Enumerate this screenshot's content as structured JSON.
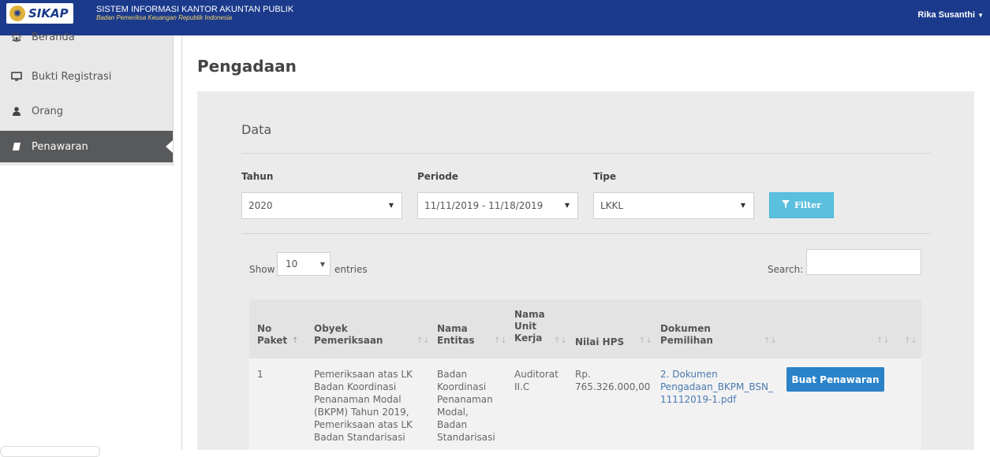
{
  "header": {
    "logo_text": "SIKAP",
    "title": "SISTEM INFORMASI KANTOR AKUNTAN PUBLIK",
    "subtitle": "Badan Pemeriksa Keuangan Republik Indonesia",
    "user_name": "Rika Susanthi"
  },
  "sidebar": {
    "items": [
      {
        "label": "Beranda",
        "icon": "home-icon"
      },
      {
        "label": "Bukti Registrasi",
        "icon": "monitor-icon"
      },
      {
        "label": "Orang",
        "icon": "user-icon"
      },
      {
        "label": "Penawaran",
        "icon": "book-icon",
        "active": true
      }
    ]
  },
  "page": {
    "title": "Pengadaan",
    "section_title": "Data"
  },
  "filters": {
    "tahun": {
      "label": "Tahun",
      "value": "2020"
    },
    "periode": {
      "label": "Periode",
      "value": "11/11/2019 - 11/18/2019"
    },
    "tipe": {
      "label": "Tipe",
      "value": "LKKL"
    },
    "filter_label": "Filter"
  },
  "table_controls": {
    "show_label": "Show",
    "page_length": "10",
    "entries_label": "entries",
    "search_label": "Search:",
    "search_value": ""
  },
  "table": {
    "headers": [
      {
        "line1": "No",
        "line2": "Paket"
      },
      {
        "line1": "Obyek",
        "line2": "Pemeriksaan"
      },
      {
        "line1": "Nama",
        "line2": "Entitas"
      },
      {
        "line1": "Nama",
        "line2": "Unit",
        "line3": "Kerja"
      },
      {
        "line1": "Nilai HPS"
      },
      {
        "line1": "Dokumen",
        "line2": "Pemilihan"
      }
    ],
    "rows": [
      {
        "no": "1",
        "obyek": [
          "Pemeriksaan atas LK",
          "Badan Koordinasi",
          "Penanaman Modal",
          "(BKPM) Tahun 2019,",
          "Pemeriksaan atas LK",
          "Badan Standarisasi"
        ],
        "entitas": [
          "Badan",
          "Koordinasi",
          "Penanaman",
          "Modal,",
          "Badan",
          "Standarisasi"
        ],
        "unit": [
          "Auditorat",
          "II.C"
        ],
        "nilai": [
          "Rp.",
          "765.326.000,00"
        ],
        "dokumen": [
          "2. Dokumen",
          "Pengadaan_BKPM_BSN_",
          "11112019-1.pdf"
        ],
        "action_label": "Buat Penawaran"
      }
    ]
  },
  "colors": {
    "topbar": "#1b3a8c",
    "sidebar_active": "#58595b",
    "filter_button": "#5bc0de",
    "action_button": "#2a82c8",
    "link": "#4a7ab0"
  }
}
